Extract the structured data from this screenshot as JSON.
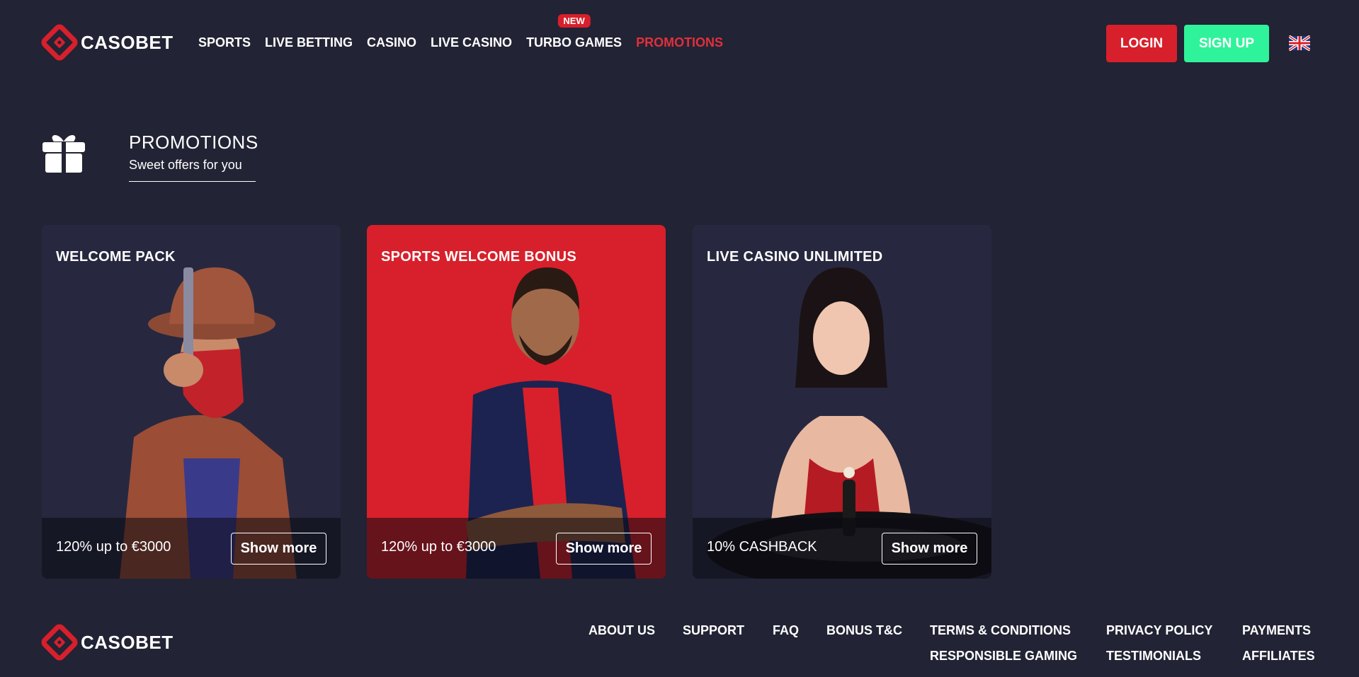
{
  "brand": {
    "name": "CASOBET",
    "accent": "#d7202b",
    "signup_color": "#2ff39a",
    "background": "#222334"
  },
  "nav": {
    "items": [
      {
        "label": "SPORTS"
      },
      {
        "label": "LIVE BETTING"
      },
      {
        "label": "CASINO"
      },
      {
        "label": "LIVE CASINO"
      },
      {
        "label": "TURBO GAMES",
        "badge": "NEW"
      },
      {
        "label": "PROMOTIONS",
        "active": true
      }
    ]
  },
  "auth": {
    "login_label": "LOGIN",
    "signup_label": "SIGN UP"
  },
  "language": {
    "icon": "uk-flag-icon"
  },
  "promotions": {
    "icon": "gift-icon",
    "title": "PROMOTIONS",
    "subtitle": "Sweet offers for you"
  },
  "cards": [
    {
      "title": "WELCOME PACK",
      "offer": "120% up to €3000",
      "button": "Show more",
      "color": "#27283f"
    },
    {
      "title": "SPORTS WELCOME BONUS",
      "offer": "120% up to €3000",
      "button": "Show more",
      "color": "#d7202b"
    },
    {
      "title": "LIVE CASINO UNLIMITED",
      "offer": "10% CASHBACK",
      "button": "Show more",
      "color": "#27283f"
    }
  ],
  "footer": {
    "links": [
      {
        "label": "ABOUT US"
      },
      {
        "label": "SUPPORT"
      },
      {
        "label": "FAQ"
      },
      {
        "label": "BONUS T&C"
      },
      {
        "label": "TERMS & CONDITIONS"
      },
      {
        "label": "PRIVACY POLICY"
      },
      {
        "label": "PAYMENTS"
      },
      {
        "label": "RESPONSIBLE GAMING"
      },
      {
        "label": "TESTIMONIALS"
      },
      {
        "label": "AFFILIATES"
      }
    ]
  }
}
